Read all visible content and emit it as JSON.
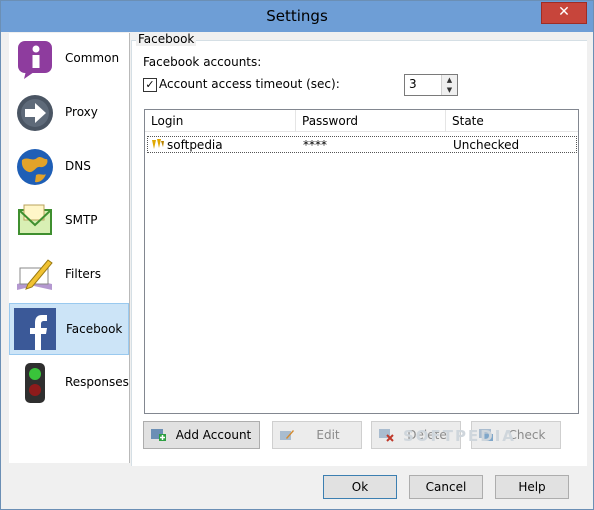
{
  "window": {
    "title": "Settings",
    "close_glyph": "✕"
  },
  "sidebar": {
    "items": [
      {
        "label": "Common",
        "icon": "info-icon"
      },
      {
        "label": "Proxy",
        "icon": "proxy-arrow-icon"
      },
      {
        "label": "DNS",
        "icon": "globe-icon"
      },
      {
        "label": "SMTP",
        "icon": "mail-icon"
      },
      {
        "label": "Filters",
        "icon": "filter-pencil-icon"
      },
      {
        "label": "Facebook",
        "icon": "facebook-icon",
        "selected": true
      },
      {
        "label": "Responses",
        "icon": "traffic-light-icon"
      }
    ]
  },
  "panel": {
    "group_title": "Facebook",
    "accounts_label": "Facebook accounts:",
    "timeout_checkbox_label": "Account access timeout (sec):",
    "timeout_checked": true,
    "timeout_value": "3",
    "table": {
      "columns": [
        "Login",
        "Password",
        "State"
      ],
      "rows": [
        {
          "login": "softpedia",
          "password": "****",
          "state": "Unchecked"
        }
      ]
    },
    "buttons": {
      "add": "Add Account",
      "edit": "Edit",
      "delete": "Delete",
      "check": "Check"
    },
    "watermark": "SOFTPEDIA"
  },
  "footer": {
    "ok": "Ok",
    "cancel": "Cancel",
    "help": "Help"
  },
  "colors": {
    "titlebar": "#6e9ed6",
    "close": "#c7453b",
    "selection": "#cce4f7"
  }
}
